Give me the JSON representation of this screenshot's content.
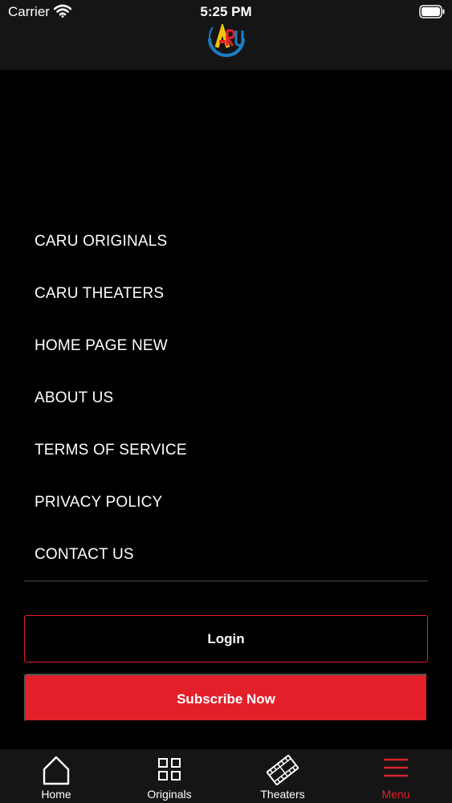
{
  "status_bar": {
    "carrier": "Carrier",
    "time": "5:25 PM"
  },
  "header": {
    "logo_icon": "caru-logo"
  },
  "menu": {
    "items": [
      {
        "label": "CARU ORIGINALS"
      },
      {
        "label": "CARU THEATERS"
      },
      {
        "label": "HOME PAGE NEW"
      },
      {
        "label": "ABOUT US"
      },
      {
        "label": "TERMS OF SERVICE"
      },
      {
        "label": "PRIVACY POLICY"
      },
      {
        "label": "CONTACT US"
      }
    ]
  },
  "actions": {
    "login_label": "Login",
    "subscribe_label": "Subscribe Now"
  },
  "tab_bar": {
    "active_tab": "Menu",
    "tabs": [
      {
        "label": "Home",
        "icon": "home-icon"
      },
      {
        "label": "Originals",
        "icon": "grid-icon"
      },
      {
        "label": "Theaters",
        "icon": "film-icon"
      },
      {
        "label": "Menu",
        "icon": "menu-icon"
      }
    ]
  },
  "colors": {
    "background": "#000000",
    "bar": "#151515",
    "accent": "#e3202a",
    "divider": "#4a4a4a"
  }
}
